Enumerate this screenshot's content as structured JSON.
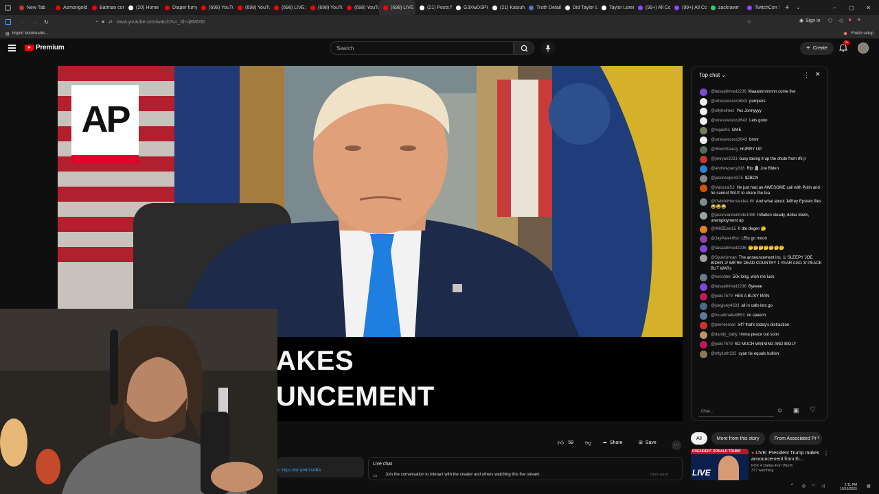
{
  "tabs": [
    {
      "label": "New Tab",
      "color": "#c0392b"
    },
    {
      "label": "Asmongold",
      "color": "#ff0000"
    },
    {
      "label": "Batman cor",
      "color": "#ff0000"
    },
    {
      "label": "(20) Home",
      "color": "#ffffff"
    },
    {
      "label": "Diaper furry",
      "color": "#ff0000"
    },
    {
      "label": "(698) YouTu",
      "color": "#ff0000"
    },
    {
      "label": "(698) YouTu",
      "color": "#ff0000"
    },
    {
      "label": "(698) LIVE:",
      "color": "#ff0000"
    },
    {
      "label": "(698) YouTu",
      "color": "#ff0000"
    },
    {
      "label": "(698) YouTu",
      "color": "#ff0000"
    },
    {
      "label": "(698) LIVE",
      "color": "#ff0000"
    },
    {
      "label": "(21) Posts fr",
      "color": "#ffffff"
    },
    {
      "label": "G3XwDSPW",
      "color": "#ffffff"
    },
    {
      "label": "(21) Katsuh",
      "color": "#ffffff"
    },
    {
      "label": "Truth Detail",
      "color": "#5b6fd6"
    },
    {
      "label": "Did Taylor Li",
      "color": "#ffffff"
    },
    {
      "label": "Taylor Lorer",
      "color": "#ffffff"
    },
    {
      "label": "(99+) All Co",
      "color": "#9146ff"
    },
    {
      "label": "(99+) All Co",
      "color": "#9146ff"
    },
    {
      "label": "zackrawrr",
      "color": "#2ecc71"
    },
    {
      "label": "TwitchCon S",
      "color": "#9146ff"
    }
  ],
  "browser": {
    "url": "www.youtube.com/watch?v=_Xh-ij8MD30",
    "sign_in": "Sign in",
    "import_bookmarks": "Import bookmarks...",
    "finish_setup": "Finish setup"
  },
  "header": {
    "logo": "Premium",
    "search_placeholder": "Search",
    "create": "Create",
    "notif_badge": "9+"
  },
  "video": {
    "corner_logo": "AP",
    "line1": "AKES",
    "line2": "UNCEMENT"
  },
  "chat": {
    "title": "Top chat",
    "input_placeholder": "Chat...",
    "messages": [
      {
        "author": "@faisalahmed2236",
        "text": "Maaannnnnnnn come live",
        "color": "#7b4ad6"
      },
      {
        "author": "@stressrecess3643",
        "text": "pumpers",
        "color": "#eeeeee"
      },
      {
        "author": "@ollyholmez",
        "text": "Yes Jonnyyyy",
        "color": "#eeeeee"
      },
      {
        "author": "@stressrecess3643",
        "text": "Lets gooo",
        "color": "#eeeeee"
      },
      {
        "author": "@regasho",
        "text": "GME",
        "color": "#6e7d5a"
      },
      {
        "author": "@stressrecess3643",
        "text": "bmnr",
        "color": "#eeeeee"
      },
      {
        "author": "@WoohSteezy",
        "text": "HURRY UP",
        "color": "#556b55"
      },
      {
        "author": "@jimryan3231",
        "text": "busy taking it up the chute from rfk jr",
        "color": "#c0392b"
      },
      {
        "author": "@andrewparry316",
        "text": "Rip 🪦 Joe Biden",
        "color": "#2d7fd3"
      },
      {
        "author": "@jasoncope4375",
        "text": "$ZBCN",
        "color": "#888888"
      },
      {
        "author": "@ValocratSJ",
        "text": "He just had an AWESOME call with Putin and he cannot WAIT to share the tea",
        "color": "#d35400"
      },
      {
        "author": "@GabrielHernandez-l6i",
        "text": "And what about Jeffrey Epstein files 😂😂😂",
        "color": "#7f8c8d"
      },
      {
        "author": "@jasonvanderlinde1066",
        "text": "Inflation steady, dollar down, unemployment up",
        "color": "#95a5a6"
      },
      {
        "author": "@WillZEee15",
        "text": "0 dte degen 🤔",
        "color": "#e67e22"
      },
      {
        "author": "@JayPatel-l6sc",
        "text": "LEts go moon",
        "color": "#8e44ad"
      },
      {
        "author": "@faisalahmed2236",
        "text": "🤔🤔🤔🤔🤔🤔🤔",
        "color": "#7b4ad6"
      },
      {
        "author": "@Syukriimran",
        "text": "The announcement inc. 1/ SLEEPY JOE BIDEN 2/ WE'RE DEAD COUNTRY 1 YEAR AGO 3/ PEACE BUT WARs",
        "color": "#a0a0a0"
      },
      {
        "author": "@konshter",
        "text": "50x long, wish me luck",
        "color": "#6c7a89"
      },
      {
        "author": "@faisalahmed2236",
        "text": "Byeeee",
        "color": "#7b4ad6"
      },
      {
        "author": "@joelc7579",
        "text": "HES A BUSY MAN",
        "color": "#c2185b"
      },
      {
        "author": "@joeyjoey4333",
        "text": "all in calls lets go",
        "color": "#4a6a7a"
      },
      {
        "author": "@fouadmatta9653",
        "text": "no speech",
        "color": "#5a7a9a"
      },
      {
        "author": "@pierreeman",
        "text": "ivf? that's today's distraction",
        "color": "#d32f2f"
      },
      {
        "author": "@dandy_baby",
        "text": "Imma peace out soon",
        "color": "#b8956a"
      },
      {
        "author": "@joelc7579",
        "text": "SO MUCH WINNING AND BIGLY",
        "color": "#c2185b"
      },
      {
        "author": "@nfty1eth232",
        "text": "cyan tie equals bullish",
        "color": "#8a7a5a"
      }
    ]
  },
  "actions": {
    "like_count": "59",
    "share": "Share",
    "save": "Save"
  },
  "description": {
    "link": "c: https://bit.ly/4n7xABA"
  },
  "live_chat_panel": {
    "title": "Live chat",
    "text": "Join the conversation to interact with the creator and others watching this live stream.",
    "button": "Open panel"
  },
  "filters": [
    "All",
    "More from this story",
    "From Associated Pr"
  ],
  "recommendation": {
    "title": "LIVE: President Trump makes announcement from th...",
    "channel": "FOX 4 Dallas-Fort Worth",
    "meta": "377 watching",
    "thumb_banner": "PRESIDENT DONALD TRUMP",
    "thumb_live": "LIVE"
  },
  "taskbar": {
    "time": "2:11 PM",
    "date": "10/16/2025"
  },
  "colors": {
    "youtube_red": "#ff0000",
    "tie_blue": "#1e7fe0",
    "ap_red": "#e4002b"
  }
}
